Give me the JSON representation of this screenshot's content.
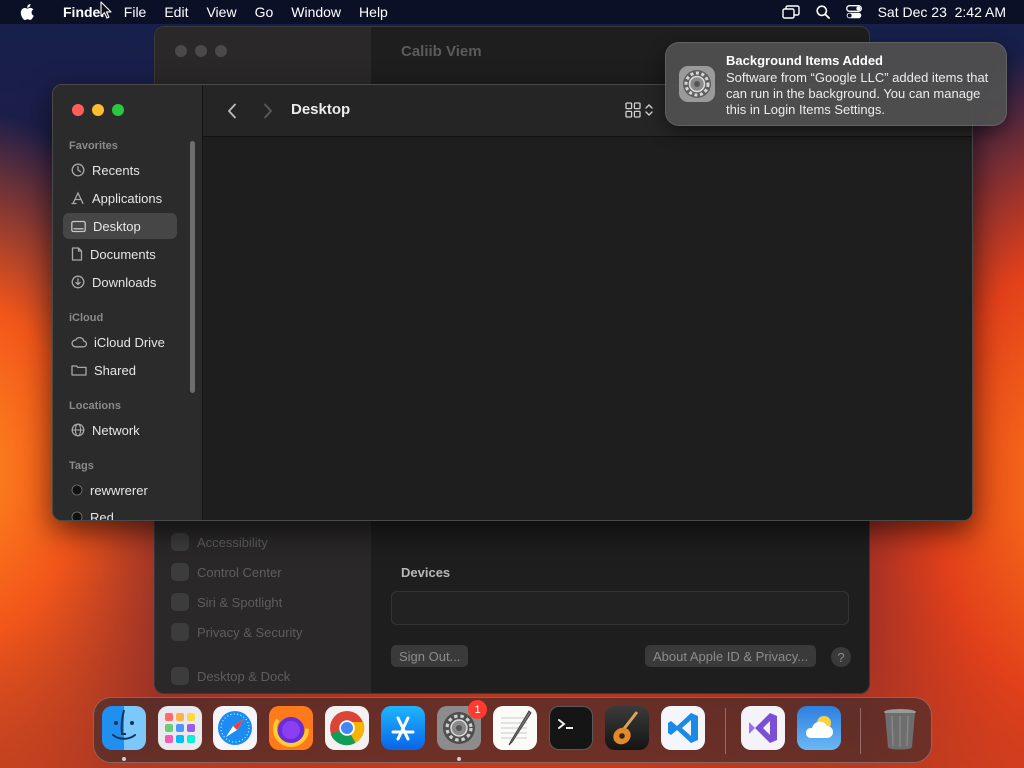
{
  "menubar": {
    "app_name": "Finder",
    "items": [
      "File",
      "Edit",
      "View",
      "Go",
      "Window",
      "Help"
    ],
    "datetime": "Sat Dec 23  2:42 AM"
  },
  "finder": {
    "current_folder": "Desktop",
    "sections": {
      "favorites": "Favorites",
      "icloud": "iCloud",
      "locations": "Locations",
      "tags": "Tags"
    },
    "favorites": [
      "Recents",
      "Applications",
      "Desktop",
      "Documents",
      "Downloads"
    ],
    "icloud_items": [
      "iCloud Drive",
      "Shared"
    ],
    "locations": [
      "Network"
    ],
    "tags": [
      "rewwrerer",
      "Red"
    ],
    "selected_item": "Desktop"
  },
  "notification": {
    "title": "Background Items Added",
    "body": "Software from “Google LLC” added items that can run in the background. You can manage this in Login Items Settings."
  },
  "settings_window": {
    "title": "Caliib Viem",
    "sidebar_items": [
      "Accessibility",
      "Control Center",
      "Siri & Spotlight",
      "Privacy & Security",
      "Desktop & Dock"
    ],
    "devices_label": "Devices",
    "sign_out_label": "Sign Out...",
    "about_label": "About Apple ID & Privacy...",
    "help_label": "?"
  },
  "dock": {
    "apps": [
      "Finder",
      "Launchpad",
      "Safari",
      "Firefox",
      "Google Chrome",
      "App Store",
      "System Settings",
      "TextEdit",
      "Terminal",
      "GarageBand",
      "Visual Studio Code",
      "Visual Studio",
      "Weather",
      "Trash"
    ],
    "settings_badge": "1"
  },
  "colors": {
    "accent_red": "#ff5f57",
    "accent_yellow": "#febc2e",
    "accent_green": "#28c840",
    "badge_red": "#ff3b30"
  }
}
